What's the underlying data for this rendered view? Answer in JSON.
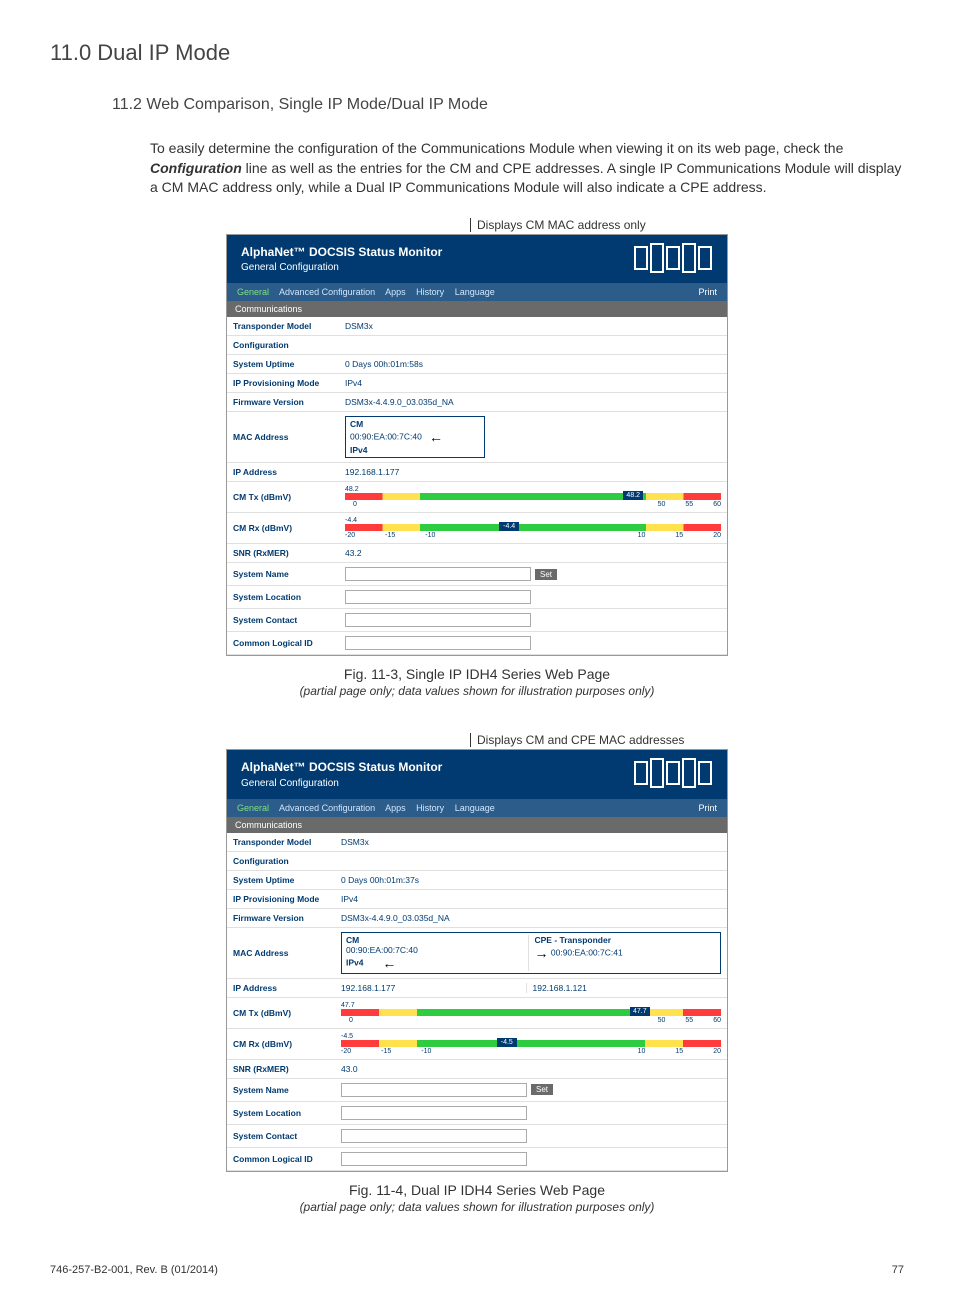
{
  "header": {
    "section_title": "11.0  Dual IP Mode",
    "subsection_title": "11.2   Web Comparison, Single IP Mode/Dual IP Mode"
  },
  "intro_para_prefix": "To easily determine the configuration of the Communications Module when viewing it on its web page, check the ",
  "intro_bold": "Configuration",
  "intro_para_suffix": " line as well as the entries for the CM and CPE addresses. A single IP Communications Module will display a CM MAC address only, while a Dual IP Communications Module will also indicate a CPE address.",
  "callout1": "Displays CM MAC address only",
  "callout2": "Displays CM and CPE MAC addresses",
  "panel": {
    "title": "AlphaNet™ DOCSIS Status Monitor",
    "subtitle": "General Configuration",
    "nav": {
      "general": "General",
      "adv": "Advanced Configuration",
      "apps": "Apps",
      "history": "History",
      "lang": "Language",
      "print": "Print"
    },
    "comm": "Communications",
    "labels": {
      "model": "Transponder Model",
      "config": "Configuration",
      "uptime": "System Uptime",
      "prov": "IP Provisioning Mode",
      "fw": "Firmware Version",
      "mac": "MAC Address",
      "ip": "IP Address",
      "tx": "CM Tx (dBmV)",
      "rx": "CM Rx (dBmV)",
      "snr": "SNR (RxMER)",
      "sysname": "System Name",
      "sysloc": "System Location",
      "syscon": "System Contact",
      "clid": "Common Logical ID"
    }
  },
  "single": {
    "model": "DSM3x",
    "uptime": "0 Days 00h:01m:58s",
    "prov": "IPv4",
    "fw": "DSM3x-4.4.9.0_03.035d_NA",
    "cm_label": "CM",
    "mac": "00:90:EA:00:7C:40",
    "ipv4": "IPv4",
    "ip": "192.168.1.177",
    "tx_val": "48.2",
    "rx_val": "-4.4",
    "snr": "43.2",
    "set": "Set"
  },
  "dual": {
    "model": "DSM3x",
    "uptime": "0 Days 00h:01m:37s",
    "prov": "IPv4",
    "fw": "DSM3x-4.4.9.0_03.035d_NA",
    "cm_label": "CM",
    "cpe_label": "CPE - Transponder",
    "mac_cm": "00:90:EA:00:7C:40",
    "mac_cpe": "00:90:EA:00:7C:41",
    "ipv4": "IPv4",
    "ip_cm": "192.168.1.177",
    "ip_cpe": "192.168.1.121",
    "tx_val": "47.7",
    "rx_val": "-4.5",
    "snr": "43.0",
    "set": "Set"
  },
  "scales": {
    "tx_zero": "0",
    "tx": [
      "50",
      "55",
      "60"
    ],
    "rx_left": [
      "-20",
      "-15",
      "-10"
    ],
    "rx_right": [
      "10",
      "15",
      "20"
    ]
  },
  "fig1": {
    "caption": "Fig. 11-3, Single IP IDH4 Series Web Page",
    "sub": "(partial page only; data values shown for illustration purposes only)"
  },
  "fig2": {
    "caption": "Fig. 11-4, Dual IP IDH4 Series Web Page",
    "sub": "(partial page only; data values shown for illustration purposes only)"
  },
  "footer": {
    "docnum": "746-257-B2-001, Rev. B (01/2014)",
    "pagenum": "77"
  }
}
